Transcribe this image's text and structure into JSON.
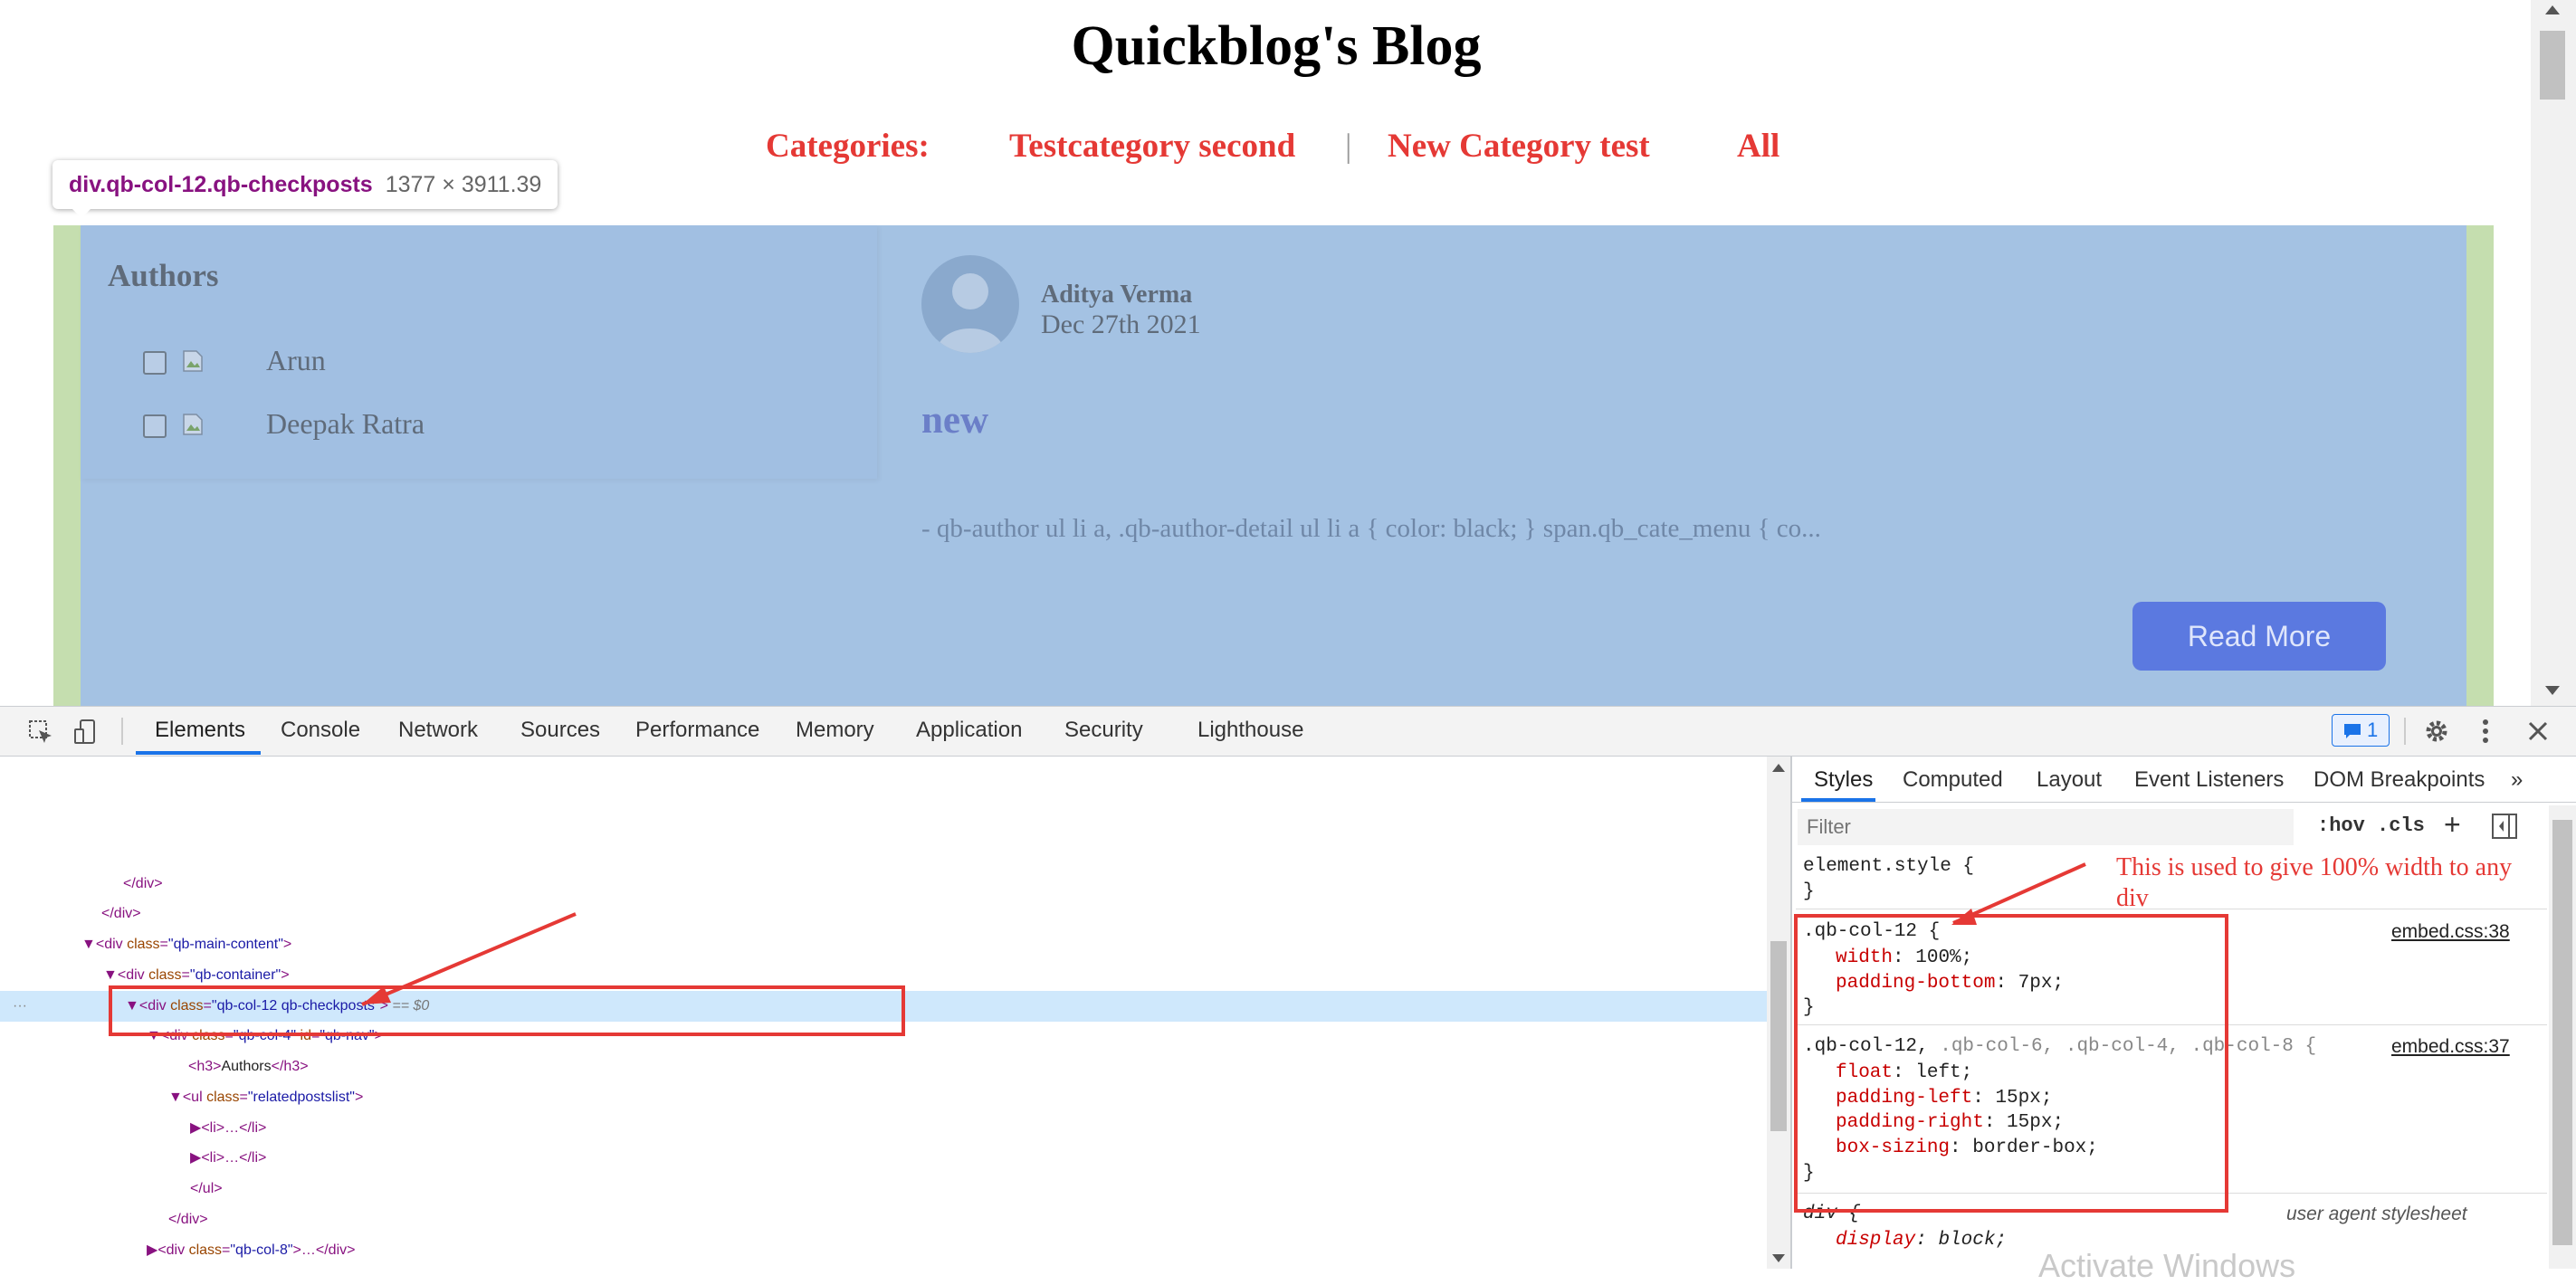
{
  "page": {
    "blog_title": "Quickblog's Blog",
    "categories_label": "Categories:",
    "categories": [
      "Testcategory second",
      "New Category test",
      "All"
    ],
    "category_separator": "|",
    "authors_heading": "Authors",
    "authors": [
      "Arun",
      "Deepak Ratra"
    ],
    "post": {
      "author": "Aditya Verma",
      "date": "Dec 27th 2021",
      "title": "new",
      "excerpt": "- qb-author ul li a, .qb-author-detail ul li a { color: black; } span.qb_cate_menu { co...",
      "read_more": "Read More"
    },
    "tooltip": {
      "selector": "div.qb-col-12.qb-checkposts",
      "size": "1377 × 3911.39"
    }
  },
  "devtools": {
    "tabs": [
      "Elements",
      "Console",
      "Network",
      "Sources",
      "Performance",
      "Memory",
      "Application",
      "Security",
      "Lighthouse"
    ],
    "active_tab": "Elements",
    "issues_count": "1",
    "styles_tabs": [
      "Styles",
      "Computed",
      "Layout",
      "Event Listeners",
      "DOM Breakpoints"
    ],
    "styles_more": "»",
    "filter_placeholder": "Filter",
    "hov": ":hov",
    "cls": ".cls",
    "plus": "+",
    "element_style": "element.style {",
    "close_brace": "}",
    "rule1": {
      "selector": ".qb-col-12 {",
      "source": "embed.css:38",
      "props": [
        [
          "width",
          "100%;"
        ],
        [
          "padding-bottom",
          "7px;"
        ]
      ]
    },
    "rule2": {
      "selector_main": ".qb-col-12,",
      "selector_rest": " .qb-col-6, .qb-col-4, .qb-col-8 {",
      "source": "embed.css:37",
      "props": [
        [
          "float",
          "left;"
        ],
        [
          "padding-left",
          "15px;"
        ],
        [
          "padding-right",
          "15px;"
        ],
        [
          "box-sizing",
          "border-box;"
        ]
      ]
    },
    "rule3": {
      "selector": "div {",
      "source": "user agent stylesheet",
      "props": [
        [
          "display",
          "block;"
        ]
      ]
    },
    "annotation": "This is used to give 100% width to any div",
    "watermark": "Activate Windows",
    "dom": {
      "l1_close": "</div>",
      "l2_close": "</div>",
      "main_tag_open": "<div ",
      "main_attr": "class",
      "main_val": "\"qb-main-content\"",
      "container_val": "\"qb-container\"",
      "checkposts_val": "\"qb-col-12 qb-checkposts\"",
      "sel_marker": "== $0",
      "col4_val": "\"qb-col-4\"",
      "col4_id_attr": "id",
      "col4_id_val": "\"qb-nav\"",
      "h3_open": "<h3>",
      "h3_text": "Authors",
      "h3_close": "</h3>",
      "ul_val": "\"relatedpostslist\"",
      "li_collapsed": "<li>…</li>",
      "ul_close": "</ul>",
      "div_close": "</div>",
      "col8_val": "\"qb-col-8\"",
      "collapsed_close": ">…</div>",
      "ellipsis": "···"
    }
  }
}
